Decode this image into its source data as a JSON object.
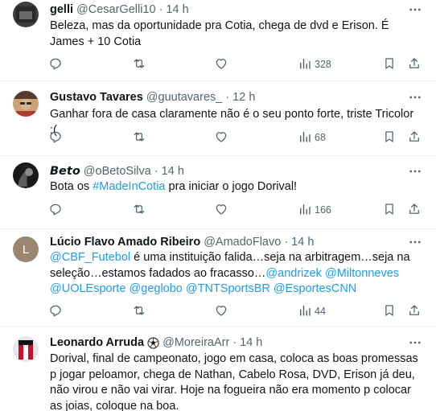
{
  "tweets": [
    {
      "name": "gelli",
      "handle": "@CesarGelli10",
      "time": "14 h",
      "text": "Beleza, mas da oportunidade pra Cotia, chega de dvd e Erison. É James + 10 Cotia",
      "views": "328"
    },
    {
      "name": "Gustavo Tavares",
      "handle": "@guutavares_",
      "time": "12 h",
      "text": "Ganhar fora de casa claramente não é o seu ponto forte, triste Tricolor :(",
      "views": "68"
    },
    {
      "name": "𝘽𝙚𝙩𝙤",
      "handle": "@oBetoSilva",
      "time": "14 h",
      "text_before": "Bota os ",
      "hashtag": "#MadeInCotia",
      "text_after": " pra iniciar o jogo Dorival!",
      "views": "166"
    },
    {
      "name": "Lúcio Flavo Amado Ribeiro",
      "handle": "@AmadoFlavo",
      "time": "14 h",
      "avatar_initial": "L",
      "mention_cbf": "@CBF_Futebol",
      "text_mid": " é uma instituição falida…seja na arbitragem…seja na seleção…estamos fadados ao fracasso…",
      "mention_andrizek": "@andrizek",
      "mention_miltonneves": "@Miltonneves",
      "mention_uolesporte": "@UOLEsporte",
      "mention_geglobo": "@geglobo",
      "mention_tntsportsbr": "@TNTSportsBR",
      "mention_esportescnn": "@EsportesCNN",
      "views": "44"
    },
    {
      "name": "Leonardo Arruda",
      "badge": "⚽",
      "handle": "@MoreiraArr",
      "time": "14 h",
      "text": "Dorival, final de campeonato, jogo em casa, coloca as boas promessas p jogar peloamor, chega de Nathan, Cabelo Rosa, DVD, Erison já deu, não virou e não vai virar. Hoje na fogueira não era momento p colocar as joias, coloque na boa."
    }
  ],
  "separator": "·",
  "colors": {
    "text": "#0f1419",
    "secondary": "#536471",
    "link": "#1d9bf0",
    "border": "#eff3f4"
  },
  "icons": [
    "more-icon",
    "reply-icon",
    "retweet-icon",
    "like-icon",
    "views-icon",
    "bookmark-icon",
    "share-icon",
    "soccer-ball-icon"
  ]
}
